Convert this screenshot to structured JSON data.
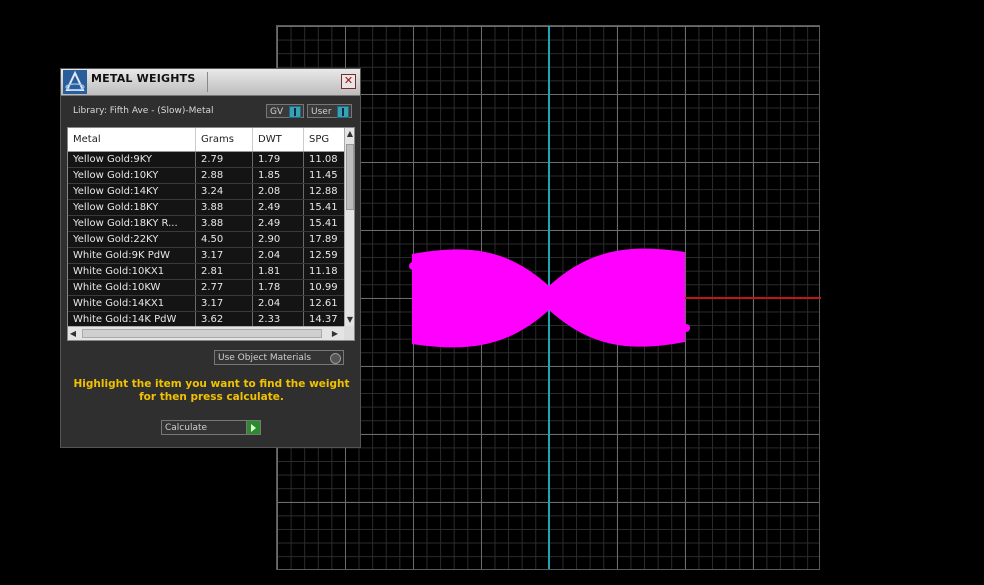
{
  "panel": {
    "title": "METAL WEIGHTS",
    "close_icon": "close-icon",
    "logo_icon": "app-logo-icon",
    "library_label": "Library: Fifth Ave - (Slow)-Metal",
    "toggle_gv": "GV",
    "toggle_user": "User",
    "use_object_materials": "Use Object Materials",
    "instructions": "Highlight the item you want to find the weight for then press calculate.",
    "calculate": "Calculate"
  },
  "table": {
    "headers": [
      "Metal",
      "Grams",
      "DWT",
      "SPG"
    ],
    "rows": [
      [
        "Yellow Gold:9KY",
        "2.79",
        "1.79",
        "11.08"
      ],
      [
        "Yellow Gold:10KY",
        "2.88",
        "1.85",
        "11.45"
      ],
      [
        "Yellow Gold:14KY",
        "3.24",
        "2.08",
        "12.88"
      ],
      [
        "Yellow Gold:18KY",
        "3.88",
        "2.49",
        "15.41"
      ],
      [
        "Yellow Gold:18KY R...",
        "3.88",
        "2.49",
        "15.41"
      ],
      [
        "Yellow Gold:22KY",
        "4.50",
        "2.90",
        "17.89"
      ],
      [
        "White Gold:9K PdW",
        "3.17",
        "2.04",
        "12.59"
      ],
      [
        "White Gold:10KX1",
        "2.81",
        "1.81",
        "11.18"
      ],
      [
        "White Gold:10KW",
        "2.77",
        "1.78",
        "10.99"
      ],
      [
        "White Gold:14KX1",
        "3.17",
        "2.04",
        "12.61"
      ],
      [
        "White Gold:14K PdW",
        "3.62",
        "2.33",
        "14.37"
      ]
    ]
  },
  "viewport": {
    "axis_y_color": "#1fa6b3",
    "axis_x_color": "#c0161a",
    "object_color": "#ff00ff"
  }
}
